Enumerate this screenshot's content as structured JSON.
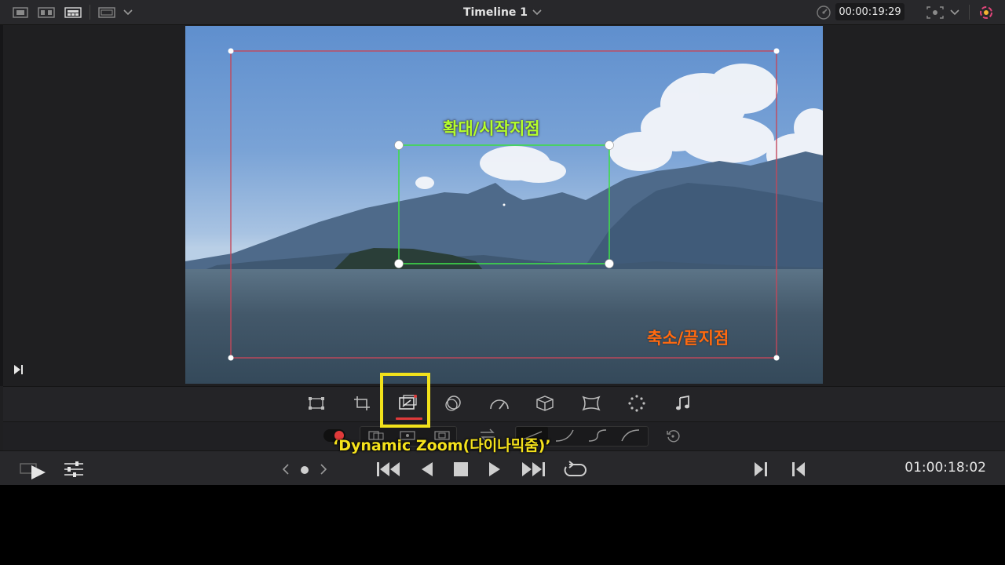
{
  "header": {
    "title": "Timeline 1",
    "timecode": "00:00:19:29"
  },
  "viewer": {
    "zoom_start_label": "확대/시작지점",
    "zoom_end_label": "축소/끝지점"
  },
  "toolbar": {
    "tools": [
      "transform-icon",
      "crop-icon",
      "dynamic-zoom-icon",
      "composite-icon",
      "speed-icon",
      "stabilization-icon",
      "lens-correction-icon",
      "retime-icon",
      "audio-icon"
    ],
    "active_tool": "dynamic-zoom-icon"
  },
  "annotation": {
    "dynamic_zoom_label": "‘Dynamic Zoom(다이나믹줌)’"
  },
  "transport": {
    "timecode": "01:00:18:02"
  },
  "colors": {
    "highlight": "#f2e21b",
    "start_label": "#b5ff2a",
    "end_label": "#ff6a10",
    "start_box": "#3fdc4a",
    "end_box": "#c4485a",
    "active_underline": "#e03a3a"
  }
}
